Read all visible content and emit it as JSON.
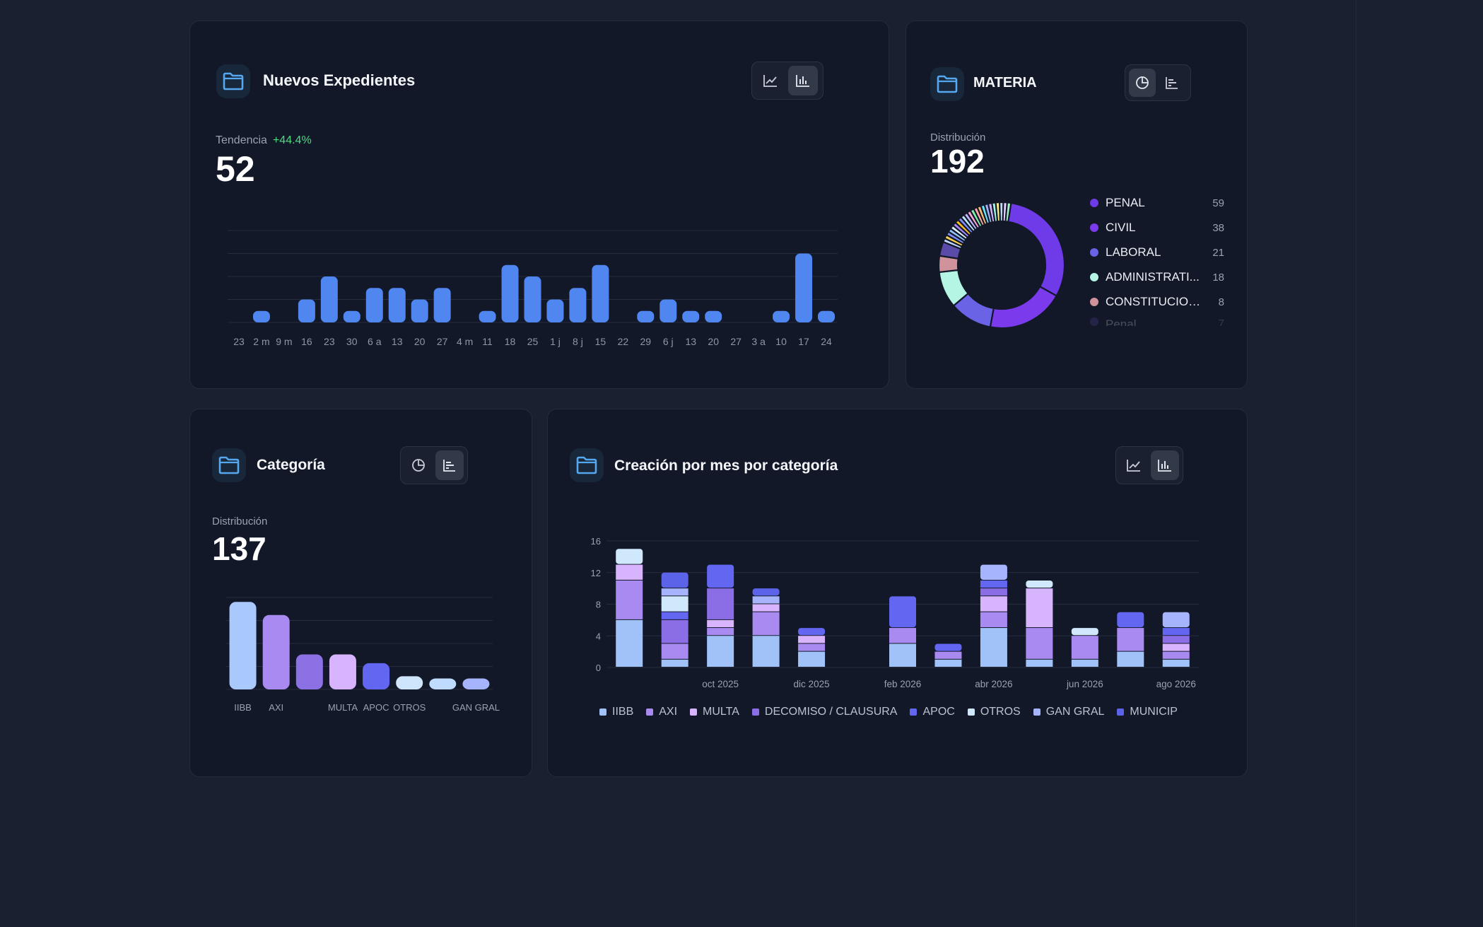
{
  "colors": {
    "accent_blue": "#4f86f0",
    "trend_green": "#4ade80",
    "folder_icon": "#55a8f0"
  },
  "icons": {
    "card_icon": "folder-icon",
    "line_toggle": "line-chart-icon",
    "bar_toggle": "bar-chart-icon",
    "pie_toggle": "pie-chart-icon",
    "hbar_toggle": "horizontal-bar-chart-icon"
  },
  "nuevos": {
    "title": "Nuevos Expedientes",
    "trend_label": "Tendencia",
    "trend_value": "+44.4%",
    "total": "52"
  },
  "materia": {
    "title": "MATERIA",
    "dist_label": "Distribución",
    "total": "192",
    "legend": [
      {
        "name": "PENAL",
        "value": "59",
        "color": "#6f3ae8"
      },
      {
        "name": "CIVIL",
        "value": "38",
        "color": "#7c3aed"
      },
      {
        "name": "LABORAL",
        "value": "21",
        "color": "#6a63e6"
      },
      {
        "name": "ADMINISTRATI...",
        "value": "18",
        "color": "#b4f5e4"
      },
      {
        "name": "CONSTITUCION...",
        "value": "8",
        "color": "#d1939b"
      },
      {
        "name": "Penal",
        "value": "7",
        "color": "#5b4ba8"
      }
    ]
  },
  "categoria": {
    "title": "Categoría",
    "dist_label": "Distribución",
    "total": "137"
  },
  "creacion": {
    "title": "Creación por mes por categoría"
  },
  "chart_data": [
    {
      "type": "bar",
      "title": "Nuevos Expedientes",
      "tick_labels": [
        "23",
        "2 m",
        "9 m",
        "16",
        "23",
        "30",
        "6 a",
        "13",
        "20",
        "27",
        "4 m",
        "11",
        "18",
        "25",
        "1 j",
        "8 j",
        "15",
        "22",
        "29",
        "6 j",
        "13",
        "20",
        "27",
        "3 a",
        "10",
        "17",
        "24"
      ],
      "values": [
        0,
        1,
        0,
        2,
        4,
        1,
        3,
        3,
        2,
        3,
        0,
        1,
        5,
        4,
        2,
        3,
        5,
        0,
        1,
        2,
        1,
        1,
        0,
        0,
        1,
        6,
        1
      ],
      "ylim": [
        0,
        8
      ],
      "grid": true
    },
    {
      "type": "pie",
      "title": "MATERIA",
      "labels": [
        "PENAL",
        "CIVIL",
        "LABORAL",
        "ADMINISTRATI...",
        "CONSTITUCION...",
        "Penal"
      ],
      "values": [
        59,
        38,
        21,
        18,
        8,
        7
      ]
    },
    {
      "type": "bar",
      "title": "Categoría",
      "categories": [
        "IIBB",
        "AXI",
        "",
        "MULTA",
        "APOC",
        "OTROS",
        "",
        "GAN GRAL"
      ],
      "values": [
        40,
        34,
        16,
        16,
        12,
        6,
        5,
        5
      ],
      "colors": [
        "#a9c8fb",
        "#a98af0",
        "#8b71e4",
        "#d8b4fe",
        "#6366f1",
        "#cfe5fb",
        "#bfdbfe",
        "#a5b4fc"
      ],
      "ylim": [
        0,
        42
      ],
      "grid": true
    },
    {
      "type": "bar",
      "title": "Creación por mes por categoría",
      "stacked": true,
      "x": [
        "ago 2025",
        "sep 2025",
        "oct 2025",
        "nov 2025",
        "dic 2025",
        "ene 2026",
        "feb 2026",
        "mar 2026",
        "abr 2026",
        "may 2026",
        "jun 2026",
        "jul 2026",
        "ago 2026"
      ],
      "x_tick_labels": [
        "oct 2025",
        "dic 2025",
        "feb 2026",
        "abr 2026",
        "jun 2026",
        "ago 2026"
      ],
      "y_ticks": [
        0,
        4,
        8,
        12,
        16
      ],
      "ylim": [
        0,
        16
      ],
      "legend_position": "bottom",
      "series": [
        {
          "name": "IIBB",
          "color": "#a0c2f8",
          "values": [
            6,
            1,
            4,
            4,
            2,
            0,
            3,
            1,
            5,
            1,
            1,
            2,
            1
          ]
        },
        {
          "name": "AXI",
          "color": "#a98af0",
          "values": [
            5,
            2,
            1,
            3,
            1,
            0,
            2,
            1,
            2,
            4,
            3,
            3,
            1
          ]
        },
        {
          "name": "MULTA",
          "color": "#d8b4fe",
          "values": [
            2,
            0,
            1,
            1,
            1,
            0,
            0,
            0,
            2,
            5,
            0,
            0,
            1
          ]
        },
        {
          "name": "DECOMISO / CLAUSURA",
          "color": "#8b6ee6",
          "values": [
            0,
            3,
            4,
            0,
            0,
            0,
            0,
            0,
            1,
            0,
            0,
            0,
            1
          ]
        },
        {
          "name": "APOC",
          "color": "#6366f1",
          "values": [
            0,
            1,
            3,
            0,
            1,
            0,
            4,
            1,
            1,
            0,
            0,
            2,
            1
          ]
        },
        {
          "name": "OTROS",
          "color": "#cfe8fb",
          "values": [
            2,
            2,
            0,
            0,
            0,
            0,
            0,
            0,
            0,
            1,
            1,
            0,
            0
          ]
        },
        {
          "name": "GAN GRAL",
          "color": "#a5b4fc",
          "values": [
            0,
            1,
            0,
            1,
            0,
            0,
            0,
            0,
            2,
            0,
            0,
            0,
            2
          ]
        },
        {
          "name": "MUNICIP",
          "color": "#5b63e8",
          "values": [
            0,
            2,
            0,
            1,
            0,
            0,
            0,
            0,
            0,
            0,
            0,
            0,
            0
          ]
        }
      ]
    }
  ]
}
